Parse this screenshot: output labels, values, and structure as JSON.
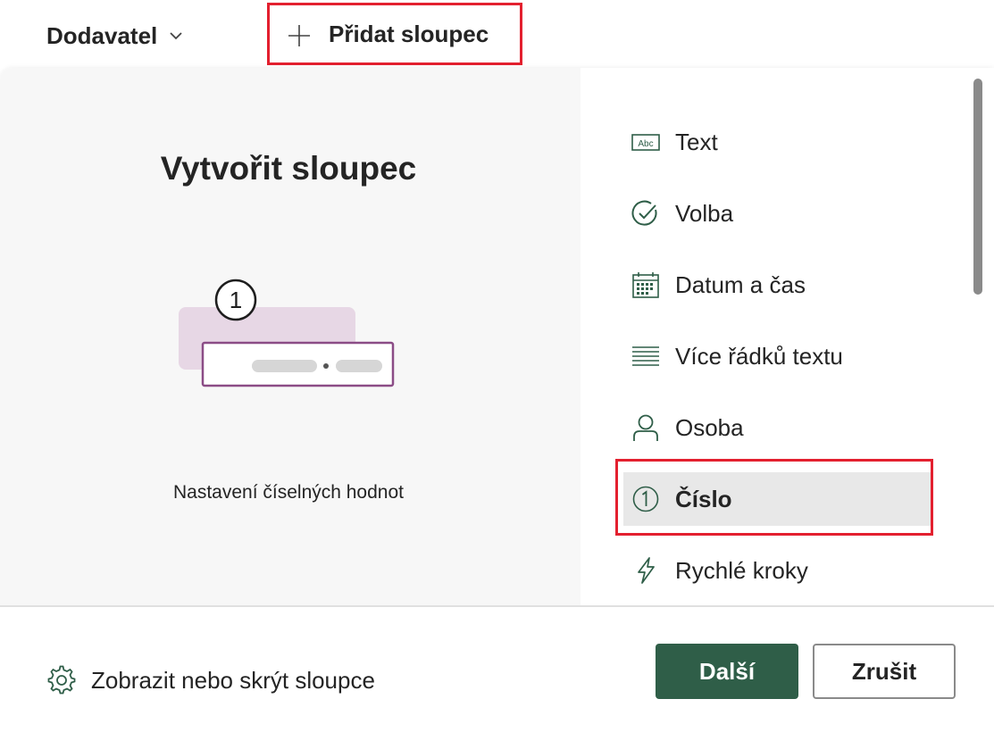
{
  "header": {
    "column_name": "Dodavatel",
    "add_column_label": "Přidat sloupec"
  },
  "panel": {
    "title": "Vytvořit sloupec",
    "preview_badge": "1",
    "description": "Nastavení číselných hodnot",
    "types": [
      {
        "label": "Text",
        "icon": "text-abc-icon"
      },
      {
        "label": "Volba",
        "icon": "check-circle-icon"
      },
      {
        "label": "Datum a čas",
        "icon": "calendar-icon"
      },
      {
        "label": "Více řádků textu",
        "icon": "multiline-text-icon"
      },
      {
        "label": "Osoba",
        "icon": "person-icon"
      },
      {
        "label": "Číslo",
        "icon": "number-icon",
        "selected": true
      },
      {
        "label": "Rychlé kroky",
        "icon": "lightning-icon"
      }
    ],
    "text_icon_label": "Abc"
  },
  "footer": {
    "show_hide_label": "Zobrazit nebo skrýt sloupce",
    "next_label": "Další",
    "cancel_label": "Zrušit"
  },
  "colors": {
    "accent": "#2f5e48",
    "highlight_border": "#e3202f",
    "icon": "#2f5e48",
    "selected_bg": "#e8e8e8"
  }
}
